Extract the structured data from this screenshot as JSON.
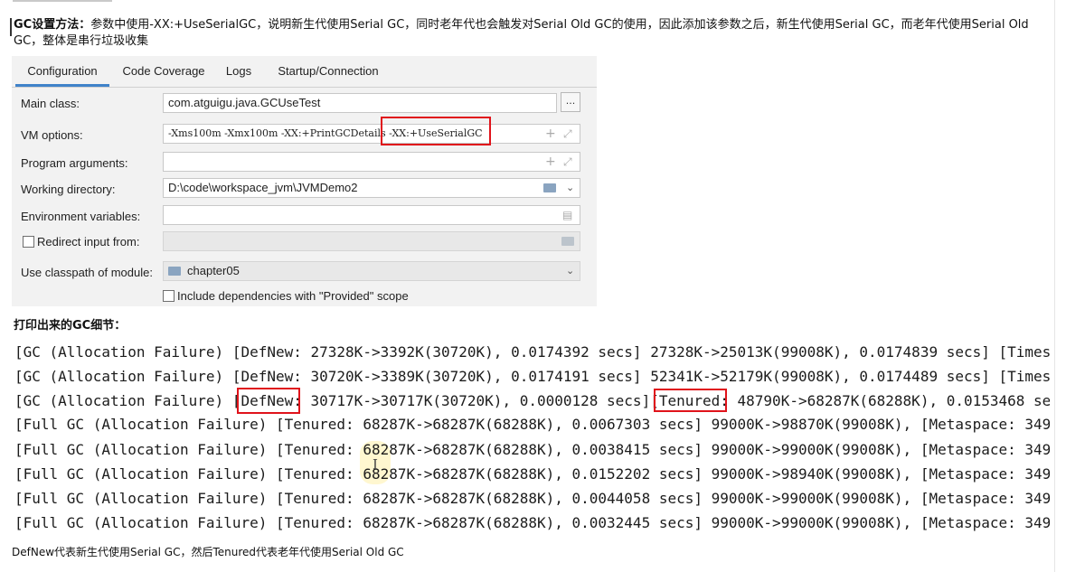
{
  "intro": {
    "bold": "GC设置方法：",
    "text": "参数中使用-XX:+UseSerialGC，说明新生代使用Serial GC，同时老年代也会触发对Serial Old GC的使用，因此添加该参数之后，新生代使用Serial GC，而老年代使用Serial Old GC，整体是串行垃圾收集"
  },
  "dialog": {
    "tabs": [
      "Configuration",
      "Code Coverage",
      "Logs",
      "Startup/Connection"
    ],
    "main_class": {
      "label": "Main class:",
      "value": "com.atguigu.java.GCUseTest",
      "button": "..."
    },
    "vm_options": {
      "label": "VM options:",
      "value": "-Xms100m -Xmx100m -XX:+PrintGCDetails -XX:+UseSerialGC"
    },
    "program_arguments": {
      "label": "Program arguments:",
      "value": ""
    },
    "working_directory": {
      "label": "Working directory:",
      "value": "D:\\code\\workspace_jvm\\JVMDemo2"
    },
    "environment_variables": {
      "label": "Environment variables:",
      "value": ""
    },
    "redirect_input": {
      "label": "Redirect input from:",
      "checked": false,
      "value": ""
    },
    "classpath_module": {
      "label": "Use classpath of module:",
      "value": "chapter05"
    },
    "include_deps": {
      "label": "Include dependencies with \"Provided\" scope",
      "checked": false
    },
    "icons": {
      "add": "plus-icon",
      "expand": "expand-icon",
      "folder": "folder-icon",
      "dropdown": "chevron-down-icon",
      "doc": "document-icon"
    }
  },
  "subtitle": "打印出来的GC细节：",
  "log_lines": [
    "[GC (Allocation Failure) [DefNew: 27328K->3392K(30720K), 0.0174392 secs] 27328K->25013K(99008K), 0.0174839 secs] [Times",
    "[GC (Allocation Failure) [DefNew: 30720K->3389K(30720K), 0.0174191 secs] 52341K->52179K(99008K), 0.0174489 secs] [Times",
    "[GC (Allocation Failure) [DefNew: 30717K->30717K(30720K), 0.0000128 secs][Tenured: 48790K->68287K(68288K), 0.0153468 se",
    "[Full GC (Allocation Failure) [Tenured: 68287K->68287K(68288K), 0.0067303 secs] 99000K->98870K(99008K), [Metaspace: 349",
    "[Full GC (Allocation Failure) [Tenured: 68287K->68287K(68288K), 0.0038415 secs] 99000K->99000K(99008K), [Metaspace: 349",
    "[Full GC (Allocation Failure) [Tenured: 68287K->68287K(68288K), 0.0152202 secs] 99000K->98940K(99008K), [Metaspace: 349",
    "[Full GC (Allocation Failure) [Tenured: 68287K->68287K(68288K), 0.0044058 secs] 99000K->99000K(99008K), [Metaspace: 349",
    "[Full GC (Allocation Failure) [Tenured: 68287K->68287K(68288K), 0.0032445 secs] 99000K->99000K(99008K), [Metaspace: 349"
  ],
  "footer": "DefNew代表新生代使用Serial GC，然后Tenured代表老年代使用Serial Old GC",
  "colors": {
    "highlight": "#e0131b",
    "tab_active": "#4083c9"
  }
}
